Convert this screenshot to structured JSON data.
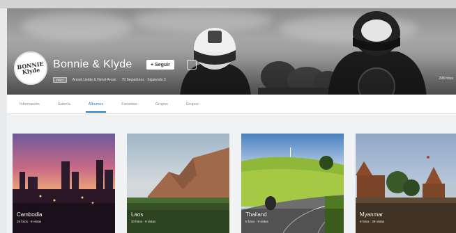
{
  "profile": {
    "title": "Bonnie & Klyde",
    "logo_text": "BONNIE Klyde",
    "follow_label": "+ Seguir",
    "badge": "PRO",
    "authors": "Anouk Lietde & Hervé Arcan",
    "stats": "70 Seguidores · Siguiendo 3",
    "views": "298 fotos"
  },
  "tabs": [
    {
      "label": "Información"
    },
    {
      "label": "Galería"
    },
    {
      "label": "Álbumes"
    },
    {
      "label": "Favoritas"
    },
    {
      "label": "Grupos"
    },
    {
      "label": "Grupos"
    }
  ],
  "active_tab": "Álbumes",
  "albums": [
    {
      "title": "Cambodia",
      "meta": "26 fotos · 8 vistas"
    },
    {
      "title": "Laos",
      "meta": "30 fotos · 9 vistas"
    },
    {
      "title": "Thailand",
      "meta": "8 fotos · 9 vistas"
    },
    {
      "title": "Myanmar",
      "meta": "9 fotos · 29 vistas"
    }
  ],
  "colors": {
    "accent": "#1f7fc9"
  }
}
